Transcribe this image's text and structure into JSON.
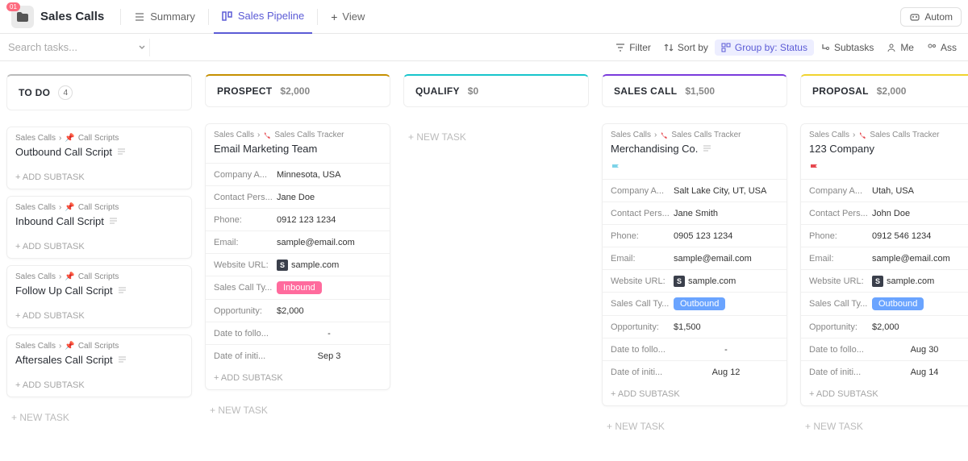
{
  "header": {
    "badge": "01",
    "title": "Sales Calls",
    "tabs": {
      "summary": "Summary",
      "pipeline": "Sales Pipeline",
      "view": "View"
    },
    "automations": "Autom"
  },
  "filters": {
    "search_placeholder": "Search tasks...",
    "filter": "Filter",
    "sort": "Sort by",
    "group": "Group by: Status",
    "subtasks": "Subtasks",
    "me": "Me",
    "assignees": "Ass"
  },
  "labels": {
    "add_subtask": "+ ADD SUBTASK",
    "new_task": "+ NEW TASK",
    "fields": {
      "company": "Company A...",
      "contact": "Contact Pers...",
      "phone": "Phone:",
      "email": "Email:",
      "website": "Website URL:",
      "call_type": "Sales Call Ty...",
      "opportunity": "Opportunity:",
      "follow": "Date to follo...",
      "initi": "Date of initi..."
    }
  },
  "columns": {
    "todo": {
      "title": "TO DO",
      "count": "4"
    },
    "prospect": {
      "title": "PROSPECT",
      "amount": "$2,000"
    },
    "qualify": {
      "title": "QUALIFY",
      "amount": "$0"
    },
    "salescall": {
      "title": "SALES CALL",
      "amount": "$1,500"
    },
    "proposal": {
      "title": "PROPOSAL",
      "amount": "$2,000"
    }
  },
  "bc": {
    "root": "Sales Calls",
    "scripts": "Call Scripts",
    "tracker": "Sales Calls Tracker"
  },
  "todo_cards": [
    {
      "title": "Outbound Call Script"
    },
    {
      "title": "Inbound Call Script"
    },
    {
      "title": "Follow Up Call Script"
    },
    {
      "title": "Aftersales Call Script"
    }
  ],
  "prospect_card": {
    "title": "Email Marketing Team",
    "company": "Minnesota, USA",
    "contact": "Jane Doe",
    "phone": "0912 123 1234",
    "email": "sample@email.com",
    "website": "sample.com",
    "calltype": "Inbound",
    "opportunity": "$2,000",
    "follow": "-",
    "initi": "Sep 3"
  },
  "salescall_card": {
    "title": "Merchandising Co.",
    "company": "Salt Lake City, UT, USA",
    "contact": "Jane Smith",
    "phone": "0905 123 1234",
    "email": "sample@email.com",
    "website": "sample.com",
    "calltype": "Outbound",
    "opportunity": "$1,500",
    "follow": "-",
    "initi": "Aug 12"
  },
  "proposal_card": {
    "title": "123 Company",
    "company": "Utah, USA",
    "contact": "John Doe",
    "phone": "0912 546 1234",
    "email": "sample@email.com",
    "website": "sample.com",
    "calltype": "Outbound",
    "opportunity": "$2,000",
    "follow": "Aug 30",
    "initi": "Aug 14"
  }
}
